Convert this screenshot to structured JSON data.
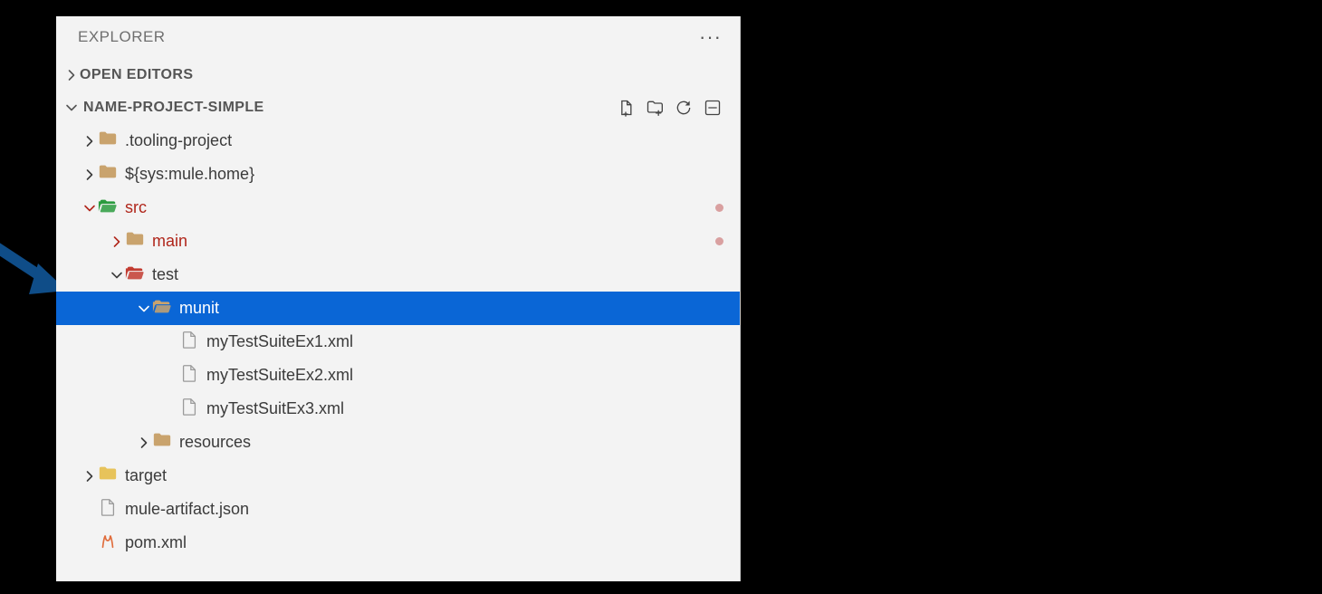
{
  "explorer": {
    "title": "EXPLORER",
    "open_editors_label": "OPEN EDITORS",
    "project_name": "NAME-PROJECT-SIMPLE"
  },
  "tree": [
    {
      "label": ".tooling-project",
      "kind": "folder",
      "icon": "folder-tan",
      "indent": 0,
      "expanded": false,
      "selected": false,
      "status": null
    },
    {
      "label": "${sys:mule.home}",
      "kind": "folder",
      "icon": "folder-tan",
      "indent": 0,
      "expanded": false,
      "selected": false,
      "status": null
    },
    {
      "label": "src",
      "kind": "folder",
      "icon": "folder-green",
      "indent": 0,
      "expanded": true,
      "selected": false,
      "status": "dot",
      "textcolor": "red"
    },
    {
      "label": "main",
      "kind": "folder",
      "icon": "folder-tan",
      "indent": 1,
      "expanded": false,
      "selected": false,
      "status": "dot",
      "textcolor": "red"
    },
    {
      "label": "test",
      "kind": "folder",
      "icon": "folder-red",
      "indent": 1,
      "expanded": true,
      "selected": false,
      "status": null
    },
    {
      "label": "munit",
      "kind": "folder",
      "icon": "folder-open",
      "indent": 2,
      "expanded": true,
      "selected": true,
      "status": null
    },
    {
      "label": "myTestSuiteEx1.xml",
      "kind": "file",
      "icon": "file",
      "indent": 3,
      "expanded": null,
      "selected": false,
      "status": null
    },
    {
      "label": "myTestSuiteEx2.xml",
      "kind": "file",
      "icon": "file",
      "indent": 3,
      "expanded": null,
      "selected": false,
      "status": null
    },
    {
      "label": "myTestSuitEx3.xml",
      "kind": "file",
      "icon": "file",
      "indent": 3,
      "expanded": null,
      "selected": false,
      "status": null
    },
    {
      "label": "resources",
      "kind": "folder",
      "icon": "folder-tan",
      "indent": 2,
      "expanded": false,
      "selected": false,
      "status": null
    },
    {
      "label": "target",
      "kind": "folder",
      "icon": "folder-yellow",
      "indent": 0,
      "expanded": false,
      "selected": false,
      "status": null
    },
    {
      "label": "mule-artifact.json",
      "kind": "file",
      "icon": "file",
      "indent": 0,
      "expanded": null,
      "selected": false,
      "status": null
    },
    {
      "label": "pom.xml",
      "kind": "file",
      "icon": "maven",
      "indent": 0,
      "expanded": null,
      "selected": false,
      "status": null
    }
  ]
}
